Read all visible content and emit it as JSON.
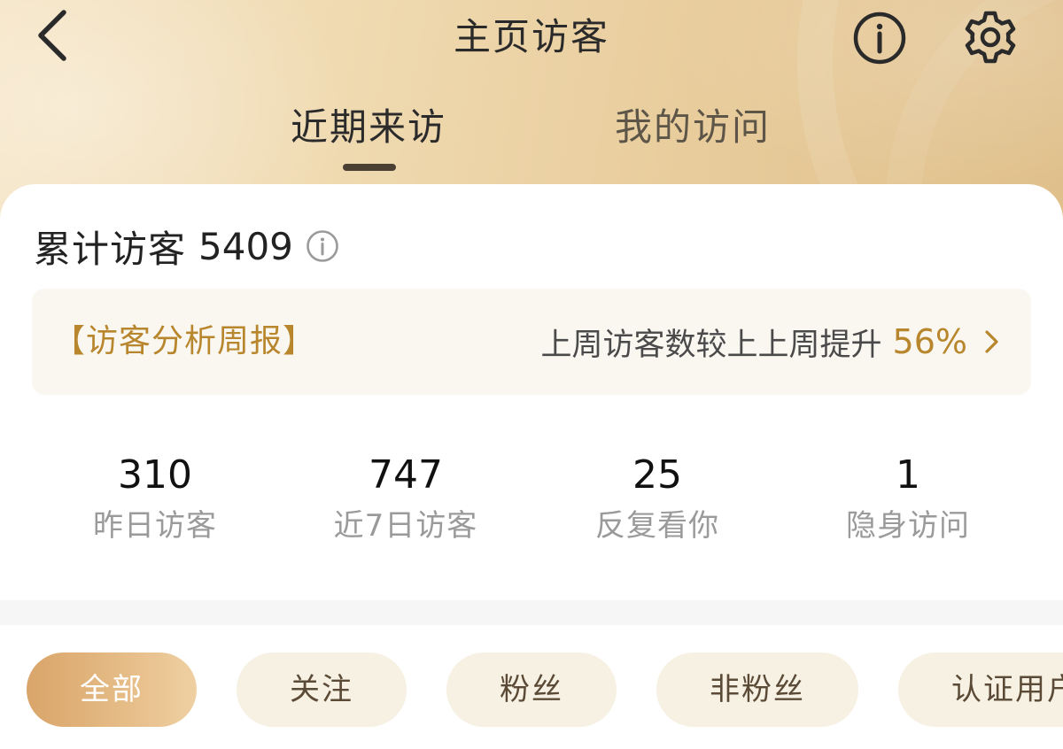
{
  "header": {
    "title": "主页访客",
    "back_icon": "chevron-left-icon",
    "info_icon": "info-circle-icon",
    "settings_icon": "gear-icon",
    "tabs": [
      {
        "label": "近期来访",
        "active": true
      },
      {
        "label": "我的访问",
        "active": false
      }
    ]
  },
  "summary": {
    "total_label": "累计访客",
    "total_value": "5409",
    "info_icon": "info-circle-icon"
  },
  "report": {
    "title": "【访客分析周报】",
    "description": "上周访客数较上上周提升",
    "percent": "56%",
    "chevron_icon": "chevron-right-icon"
  },
  "stats": [
    {
      "value": "310",
      "label": "昨日访客"
    },
    {
      "value": "747",
      "label": "近7日访客"
    },
    {
      "value": "25",
      "label": "反复看你"
    },
    {
      "value": "1",
      "label": "隐身访问"
    }
  ],
  "filters": [
    {
      "label": "全部",
      "active": true
    },
    {
      "label": "关注",
      "active": false
    },
    {
      "label": "粉丝",
      "active": false
    },
    {
      "label": "非粉丝",
      "active": false
    },
    {
      "label": "认证用户",
      "active": false
    }
  ],
  "colors": {
    "accent_gold": "#b8862c",
    "header_gradient_start": "#f5e4c4",
    "header_gradient_end": "#dfbf8a",
    "active_chip": "#d9a56a",
    "chip_bg": "#f7f1e4",
    "tab_indicator": "#4a3f33"
  }
}
